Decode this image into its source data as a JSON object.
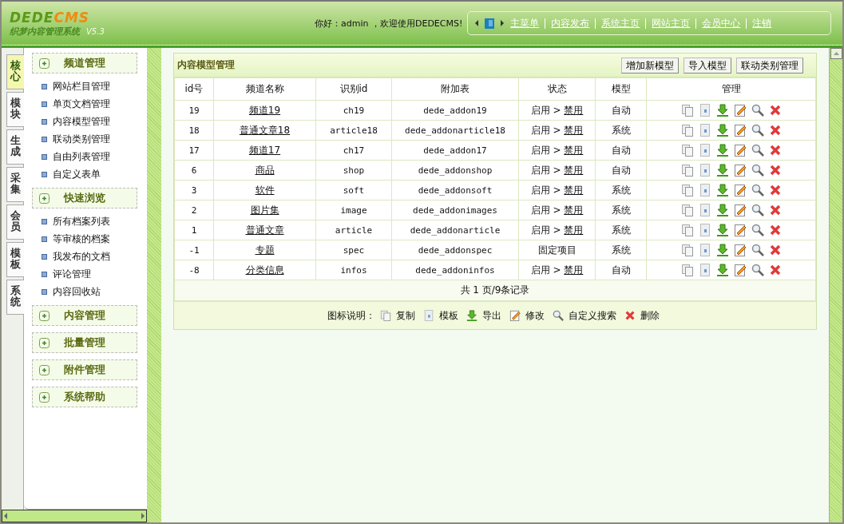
{
  "header": {
    "logo_main": "DEDE",
    "logo_accent": "CMS",
    "subtitle": "织梦内容管理系统",
    "version": "V5.3",
    "greeting": "你好：admin ，欢迎使用DEDECMS!",
    "nav": [
      "主菜单",
      "内容发布",
      "系统主页",
      "网站主页",
      "会员中心",
      "注销"
    ]
  },
  "left_tabs": [
    {
      "label": "核心",
      "selected": true
    },
    {
      "label": "模块",
      "selected": false
    },
    {
      "label": "生成",
      "selected": false
    },
    {
      "label": "采集",
      "selected": false
    },
    {
      "label": "会员",
      "selected": false
    },
    {
      "label": "模板",
      "selected": false
    },
    {
      "label": "系统",
      "selected": false
    }
  ],
  "sidebar": [
    {
      "title": "频道管理",
      "items": [
        "网站栏目管理",
        "单页文档管理",
        "内容模型管理",
        "联动类别管理",
        "自由列表管理",
        "自定义表单"
      ]
    },
    {
      "title": "快速浏览",
      "items": [
        "所有档案列表",
        "等审核的档案",
        "我发布的文档",
        "评论管理",
        "内容回收站"
      ]
    },
    {
      "title": "内容管理"
    },
    {
      "title": "批量管理"
    },
    {
      "title": "附件管理"
    },
    {
      "title": "系统帮助"
    }
  ],
  "panel": {
    "title": "内容模型管理",
    "buttons": [
      "增加新模型",
      "导入模型",
      "联动类别管理"
    ],
    "columns": [
      "id号",
      "频道名称",
      "识别id",
      "附加表",
      "状态",
      "模型",
      "管理"
    ],
    "rows": [
      {
        "id": "19",
        "name": "频道19",
        "ident": "ch19",
        "table": "dede_addon19",
        "status": {
          "kind": "toggle",
          "on": "启用",
          "sep": ">",
          "off": "禁用"
        },
        "model": "自动"
      },
      {
        "id": "18",
        "name": "普通文章18",
        "ident": "article18",
        "table": "dede_addonarticle18",
        "status": {
          "kind": "toggle",
          "on": "启用",
          "sep": ">",
          "off": "禁用"
        },
        "model": "系统"
      },
      {
        "id": "17",
        "name": "频道17",
        "ident": "ch17",
        "table": "dede_addon17",
        "status": {
          "kind": "toggle",
          "on": "启用",
          "sep": ">",
          "off": "禁用"
        },
        "model": "自动"
      },
      {
        "id": "6",
        "name": "商品",
        "ident": "shop",
        "table": "dede_addonshop",
        "status": {
          "kind": "toggle",
          "on": "启用",
          "sep": ">",
          "off": "禁用"
        },
        "model": "自动"
      },
      {
        "id": "3",
        "name": "软件",
        "ident": "soft",
        "table": "dede_addonsoft",
        "status": {
          "kind": "toggle",
          "on": "启用",
          "sep": ">",
          "off": "禁用"
        },
        "model": "系统"
      },
      {
        "id": "2",
        "name": "图片集",
        "ident": "image",
        "table": "dede_addonimages",
        "status": {
          "kind": "toggle",
          "on": "启用",
          "sep": ">",
          "off": "禁用"
        },
        "model": "系统"
      },
      {
        "id": "1",
        "name": "普通文章",
        "ident": "article",
        "table": "dede_addonarticle",
        "status": {
          "kind": "toggle",
          "on": "启用",
          "sep": ">",
          "off": "禁用"
        },
        "model": "系统"
      },
      {
        "id": "-1",
        "name": "专题",
        "ident": "spec",
        "table": "dede_addonspec",
        "status": {
          "kind": "fixed",
          "text": "固定项目"
        },
        "model": "系统"
      },
      {
        "id": "-8",
        "name": "分类信息",
        "ident": "infos",
        "table": "dede_addoninfos",
        "status": {
          "kind": "toggle",
          "on": "启用",
          "sep": ">",
          "off": "禁用"
        },
        "model": "自动"
      }
    ],
    "pager": "共 1 页/9条记录",
    "legend_label": "图标说明：",
    "legend": [
      {
        "kind": "copy",
        "label": "复制"
      },
      {
        "kind": "template",
        "label": "模板"
      },
      {
        "kind": "export",
        "label": "导出"
      },
      {
        "kind": "edit",
        "label": "修改"
      },
      {
        "kind": "search",
        "label": "自定义搜索"
      },
      {
        "kind": "delete",
        "label": "删除"
      }
    ]
  }
}
